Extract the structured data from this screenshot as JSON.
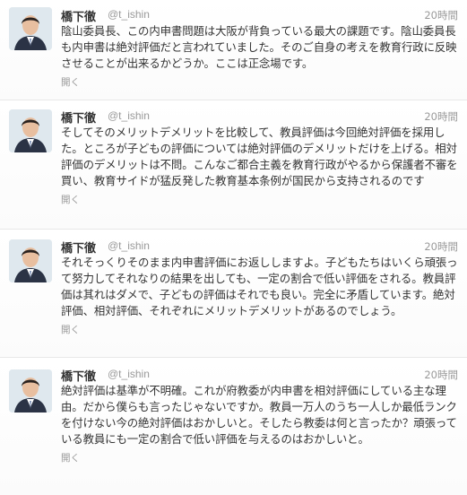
{
  "tweets": [
    {
      "name": "橋下徹",
      "handle": "@t_ishin",
      "time": "20時間",
      "text": "陰山委員長、この内申書問題は大阪が背負っている最大の課題です。陰山委員長も内申書は絶対評価だと言われていました。そのご自身の考えを教育行政に反映させることが出来るかどうか。ここは正念場です。",
      "expand": "開く"
    },
    {
      "name": "橋下徹",
      "handle": "@t_ishin",
      "time": "20時間",
      "text": "そしてそのメリットデメリットを比較して、教員評価は今回絶対評価を採用した。ところが子どもの評価については絶対評価のデメリットだけを上げる。相対評価のデメリットは不問。こんなご都合主義を教育行政がやるから保護者不審を買い、教育サイドが猛反発した教育基本条例が国民から支持されるのです",
      "expand": "開く"
    },
    {
      "name": "橋下徹",
      "handle": "@t_ishin",
      "time": "20時間",
      "text": "それそっくりそのまま内申書評価にお返ししますよ。子どもたちはいくら頑張って努力してそれなりの結果を出しても、一定の割合で低い評価をされる。教員評価は其れはダメで、子どもの評価はそれでも良い。完全に矛盾しています。絶対評価、相対評価、それぞれにメリットデメリットがあるのでしょう。",
      "expand": "開く"
    },
    {
      "name": "橋下徹",
      "handle": "@t_ishin",
      "time": "20時間",
      "text": "絶対評価は基準が不明確。これが府教委が内申書を相対評価にしている主な理由。だから僕らも言ったじゃないですか。教員一万人のうち一人しか最低ランクを付けない今の絶対評価はおかしいと。そしたら教委は何と言ったか？頑張っている教員にも一定の割合で低い評価を与えるのはおかしいと。",
      "expand": "開く"
    }
  ]
}
